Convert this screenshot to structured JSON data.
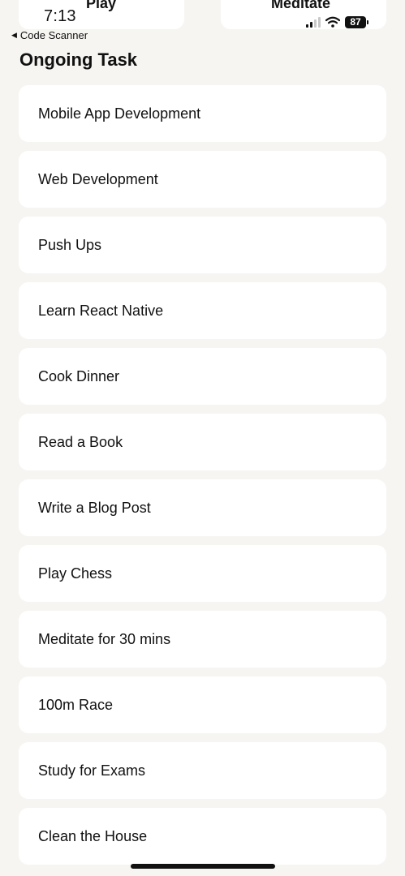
{
  "status_bar": {
    "time": "7:13",
    "battery": "87"
  },
  "top_tabs": {
    "left_label": "Play",
    "right_label": "Meditate"
  },
  "back_link": {
    "label": "Code Scanner"
  },
  "page_title": "Ongoing Task",
  "tasks": [
    "Mobile App Development",
    "Web Development",
    "Push Ups",
    "Learn React Native",
    "Cook Dinner",
    "Read a Book",
    "Write a Blog Post",
    "Play Chess",
    "Meditate for 30 mins",
    "100m Race",
    "Study for Exams",
    "Clean the House"
  ]
}
